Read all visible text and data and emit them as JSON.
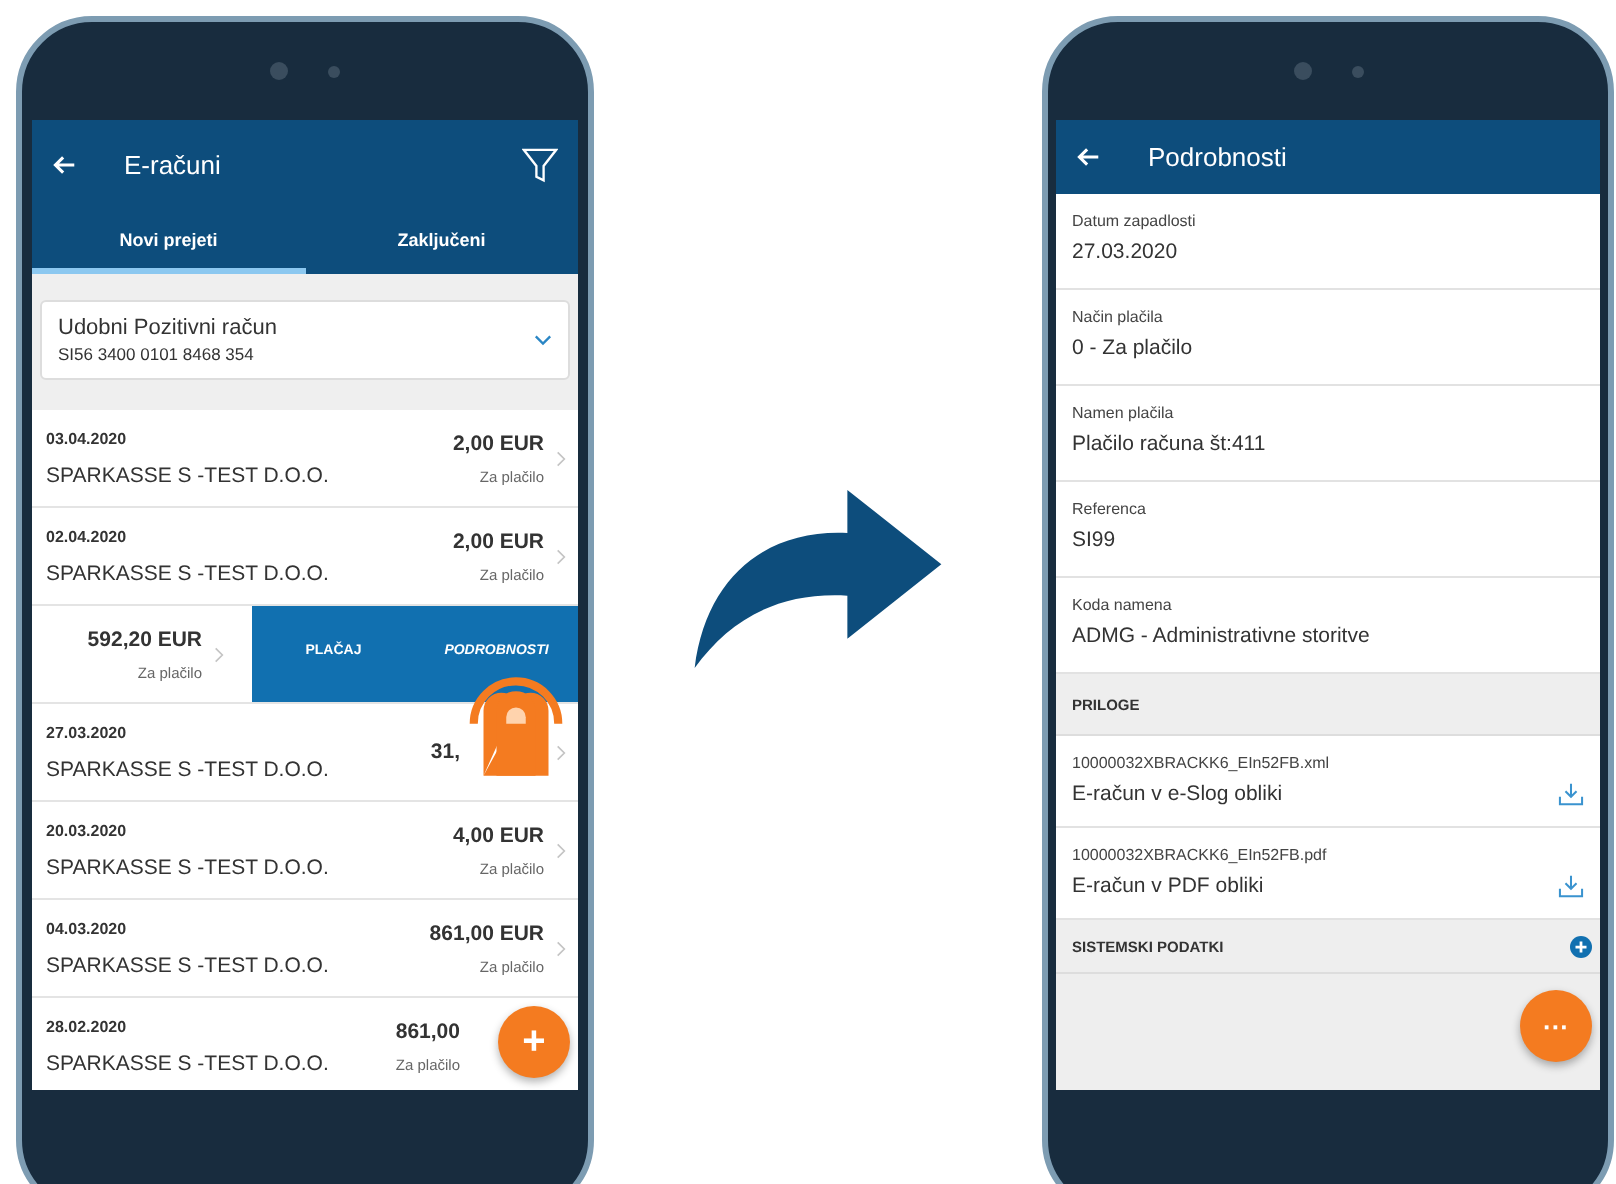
{
  "list_screen": {
    "title": "E-računi",
    "tabs": [
      {
        "label": "Novi prejeti",
        "selected": true
      },
      {
        "label": "Zaključeni",
        "selected": false
      }
    ],
    "account": {
      "name": "Udobni Pozitivni račun",
      "iban": "SI56 3400 0101 8468 354"
    },
    "bills": [
      {
        "kind": "bill",
        "date": "03.04.2020",
        "payee": "SPARKASSE S -TEST D.O.O.",
        "amount": "2,00 EUR",
        "status": "Za plačilo"
      },
      {
        "kind": "bill",
        "date": "02.04.2020",
        "payee": "SPARKASSE S -TEST D.O.O.",
        "amount": "2,00 EUR",
        "status": "Za plačilo"
      },
      {
        "kind": "swiped",
        "amount": "592,20 EUR",
        "status": "Za plačilo",
        "actions": [
          "PLAČAJ",
          "PODROBNOSTI"
        ]
      },
      {
        "kind": "bill",
        "date": "27.03.2020",
        "payee": "SPARKASSE S -TEST D.O.O.",
        "amount": "31,"
      },
      {
        "kind": "bill",
        "date": "20.03.2020",
        "payee": "SPARKASSE S -TEST D.O.O.",
        "amount": "4,00 EUR",
        "status": "Za plačilo"
      },
      {
        "kind": "bill",
        "date": "04.03.2020",
        "payee": "SPARKASSE S -TEST D.O.O.",
        "amount": "861,00 EUR",
        "status": "Za plačilo"
      },
      {
        "kind": "bill",
        "date": "28.02.2020",
        "payee": "SPARKASSE S -TEST D.O.O.",
        "amount": "861,00",
        "status": "Za plačilo"
      }
    ],
    "fab": "+"
  },
  "detail_screen": {
    "title": "Podrobnosti",
    "fields": [
      {
        "label": "Datum zapadlosti",
        "value": "27.03.2020"
      },
      {
        "label": "Način plačila",
        "value": "0 - Za plačilo"
      },
      {
        "label": "Namen plačila",
        "value": "Plačilo računa št:411"
      },
      {
        "label": "Referenca",
        "value": "SI99"
      },
      {
        "label": "Koda namena",
        "value": "ADMG - Administrativne storitve"
      }
    ],
    "sections": [
      {
        "title": "PRILOGE",
        "expanded": true,
        "attachments": [
          {
            "file": "10000032XBRACKK6_EIn52FB.xml",
            "description": "E-račun v e-Slog obliki"
          },
          {
            "file": "10000032XBRACKK6_EIn52FB.pdf",
            "description": "E-račun v PDF obliki"
          }
        ]
      },
      {
        "title": "SISTEMSKI PODATKI",
        "expanded": false
      }
    ],
    "fab": "···"
  }
}
